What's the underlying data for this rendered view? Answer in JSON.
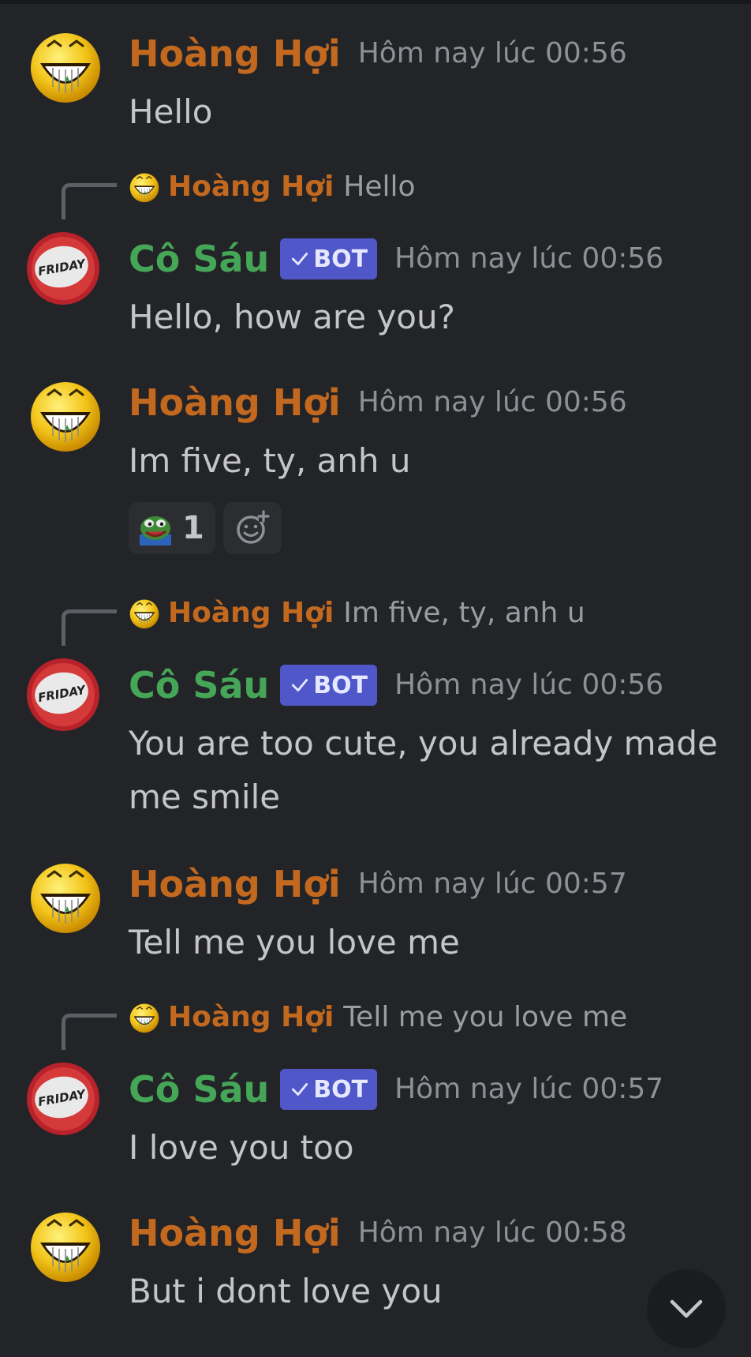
{
  "messages": [
    {
      "author": "Hoàng Hợi",
      "time": "Hôm nay lúc 00:56",
      "text": "Hello"
    },
    {
      "reply_to": {
        "author": "Hoàng Hợi",
        "text": "Hello"
      },
      "author": "Cô Sáu",
      "badge": "BOT",
      "time": "Hôm nay lúc 00:56",
      "text": "Hello, how are you?"
    },
    {
      "author": "Hoàng Hợi",
      "time": "Hôm nay lúc 00:56",
      "text": "Im five, ty, anh u",
      "reactions": [
        {
          "emoji": "pepe-emoji",
          "count": "1"
        }
      ]
    },
    {
      "reply_to": {
        "author": "Hoàng Hợi",
        "text": "Im five, ty, anh u"
      },
      "author": "Cô Sáu",
      "badge": "BOT",
      "time": "Hôm nay lúc 00:56",
      "text": "You are too cute, you already made me smile"
    },
    {
      "author": "Hoàng Hợi",
      "time": "Hôm nay lúc 00:57",
      "text": "Tell me you love me"
    },
    {
      "reply_to": {
        "author": "Hoàng Hợi",
        "text": "Tell me you love me"
      },
      "author": "Cô Sáu",
      "badge": "BOT",
      "time": "Hôm nay lúc 00:57",
      "text": "I love you too"
    },
    {
      "author": "Hoàng Hợi",
      "time": "Hôm nay lúc 00:58",
      "text": "But i dont love you"
    }
  ],
  "avatars": {
    "bot_label": "FRIDAY"
  },
  "colors": {
    "background": "#232428",
    "user_name": "#c2691f",
    "bot_name": "#45a657",
    "bot_badge": "#5058c9",
    "timestamp": "#8e9096",
    "message_text": "#c4c5c9"
  },
  "icons": {
    "user_avatar": "grinning-face-icon",
    "bot_avatar": "friday-badge-icon",
    "verified": "checkmark-icon",
    "add_reaction": "add-reaction-icon",
    "scroll_down": "chevron-down-icon"
  }
}
